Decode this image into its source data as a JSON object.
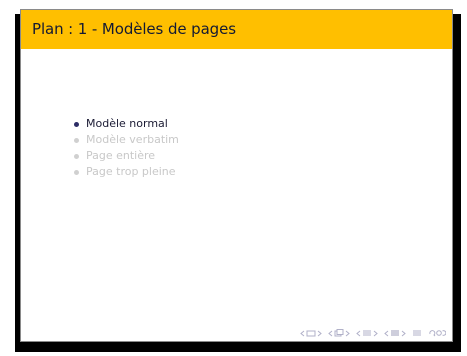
{
  "slide": {
    "title": "Plan : 1 - Modèles de pages",
    "toc": [
      {
        "label": "Modèle normal",
        "state": "active"
      },
      {
        "label": "Modèle verbatim",
        "state": "dim"
      },
      {
        "label": "Page entière",
        "state": "dim"
      },
      {
        "label": "Page trop pleine",
        "state": "dim"
      }
    ]
  },
  "colors": {
    "title_bar": "#ffbf00",
    "title_text": "#141a33",
    "active_item": "#1a1a33",
    "dim_item": "#c8c8c8",
    "nav_symbols": "#b0b0c8"
  },
  "navigation": {
    "icons": [
      "nav-slide-icon",
      "nav-frame-icon",
      "nav-subsection-icon",
      "nav-section-icon",
      "nav-align-icon",
      "nav-search-icon"
    ]
  }
}
